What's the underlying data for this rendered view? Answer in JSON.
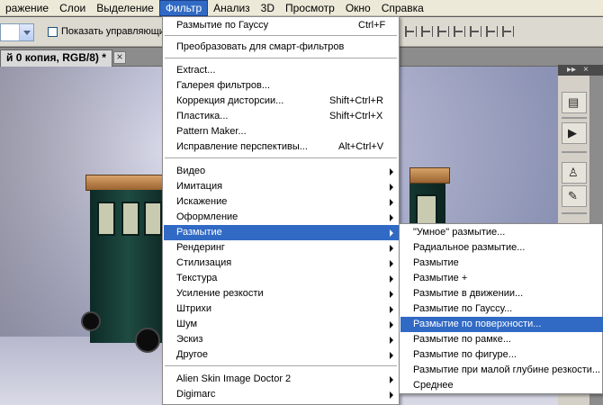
{
  "menubar": {
    "items": [
      "ражение",
      "Слои",
      "Выделение",
      "Фильтр",
      "Анализ",
      "3D",
      "Просмотр",
      "Окно",
      "Справка"
    ],
    "active_index": 3
  },
  "options": {
    "checkbox_label": "Показать управляющие"
  },
  "document": {
    "tab_title": "й 0 копия, RGB/8) *",
    "close_glyph": "×"
  },
  "side_panel": {
    "collapse_glyph": "▸▸",
    "close_glyph": "×"
  },
  "filter_menu": {
    "items": [
      {
        "label": "Размытие по Гауссу",
        "shortcut": "Ctrl+F"
      },
      {
        "label": "Преобразовать для смарт-фильтров",
        "shortcut": ""
      },
      {
        "label": "Extract...",
        "shortcut": ""
      },
      {
        "label": "Галерея фильтров...",
        "shortcut": ""
      },
      {
        "label": "Коррекция дисторсии...",
        "shortcut": "Shift+Ctrl+R"
      },
      {
        "label": "Пластика...",
        "shortcut": "Shift+Ctrl+X"
      },
      {
        "label": "Pattern Maker...",
        "shortcut": ""
      },
      {
        "label": "Исправление перспективы...",
        "shortcut": "Alt+Ctrl+V"
      },
      {
        "label": "Видео",
        "shortcut": ""
      },
      {
        "label": "Имитация",
        "shortcut": ""
      },
      {
        "label": "Искажение",
        "shortcut": ""
      },
      {
        "label": "Оформление",
        "shortcut": ""
      },
      {
        "label": "Размытие",
        "shortcut": ""
      },
      {
        "label": "Рендеринг",
        "shortcut": ""
      },
      {
        "label": "Стилизация",
        "shortcut": ""
      },
      {
        "label": "Текстура",
        "shortcut": ""
      },
      {
        "label": "Усиление резкости",
        "shortcut": ""
      },
      {
        "label": "Штрихи",
        "shortcut": ""
      },
      {
        "label": "Шум",
        "shortcut": ""
      },
      {
        "label": "Эскиз",
        "shortcut": ""
      },
      {
        "label": "Другое",
        "shortcut": ""
      },
      {
        "label": "Alien Skin Image Doctor 2",
        "shortcut": ""
      },
      {
        "label": "Digimarc",
        "shortcut": ""
      }
    ]
  },
  "blur_submenu": {
    "items": [
      "\"Умное\" размытие...",
      "Радиальное размытие...",
      "Размытие",
      "Размытие +",
      "Размытие в движении...",
      "Размытие по Гауссу...",
      "Размытие по поверхности...",
      "Размытие по рамке...",
      "Размытие по фигуре...",
      "Размытие при малой глубине резкости...",
      "Среднее"
    ]
  },
  "colors": {
    "highlight": "#316ac5",
    "menu_bg": "#ffffff",
    "menubar_bg": "#ece9d8"
  }
}
